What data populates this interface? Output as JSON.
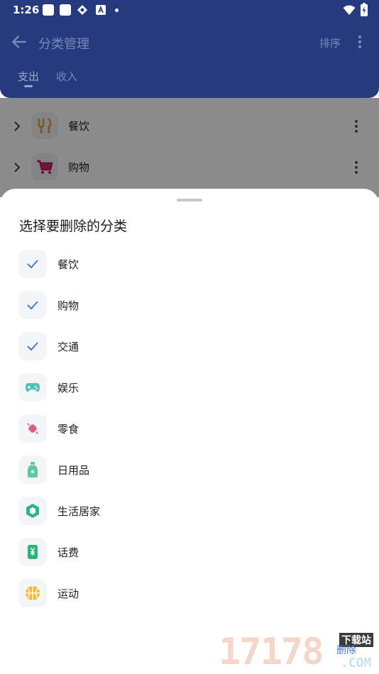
{
  "status_bar": {
    "time": "1:26"
  },
  "toolbar": {
    "title": "分类管理",
    "sort_label": "排序"
  },
  "tabs": [
    {
      "label": "支出"
    },
    {
      "label": "收入"
    }
  ],
  "background_list": [
    {
      "label": "餐饮",
      "icon": "fork-knife-icon",
      "color": "#d9a23c"
    },
    {
      "label": "购物",
      "icon": "shopping-cart-icon",
      "color": "#c2185b"
    }
  ],
  "sheet": {
    "title": "选择要删除的分类",
    "items": [
      {
        "label": "餐饮",
        "icon": "check-icon",
        "selected": true
      },
      {
        "label": "购物",
        "icon": "check-icon",
        "selected": true
      },
      {
        "label": "交通",
        "icon": "check-icon",
        "selected": true
      },
      {
        "label": "娱乐",
        "icon": "gamepad-icon",
        "color": "#4fc3b4",
        "selected": false
      },
      {
        "label": "零食",
        "icon": "candy-icon",
        "color": "#d9607e",
        "selected": false
      },
      {
        "label": "日用品",
        "icon": "bottle-icon",
        "color": "#5cc8a0",
        "selected": false
      },
      {
        "label": "生活居家",
        "icon": "cube-icon",
        "color": "#2fb58c",
        "selected": false
      },
      {
        "label": "话费",
        "icon": "phone-bill-icon",
        "color": "#26b47a",
        "selected": false
      },
      {
        "label": "运动",
        "icon": "basketball-icon",
        "color": "#f5b83d",
        "selected": false
      }
    ],
    "delete_label": "删除"
  },
  "watermark": {
    "digits": "17178",
    "top": "下载站",
    "suffix": ".COM"
  },
  "colors": {
    "appbar": "#263a7e",
    "check": "#4a78d6"
  }
}
